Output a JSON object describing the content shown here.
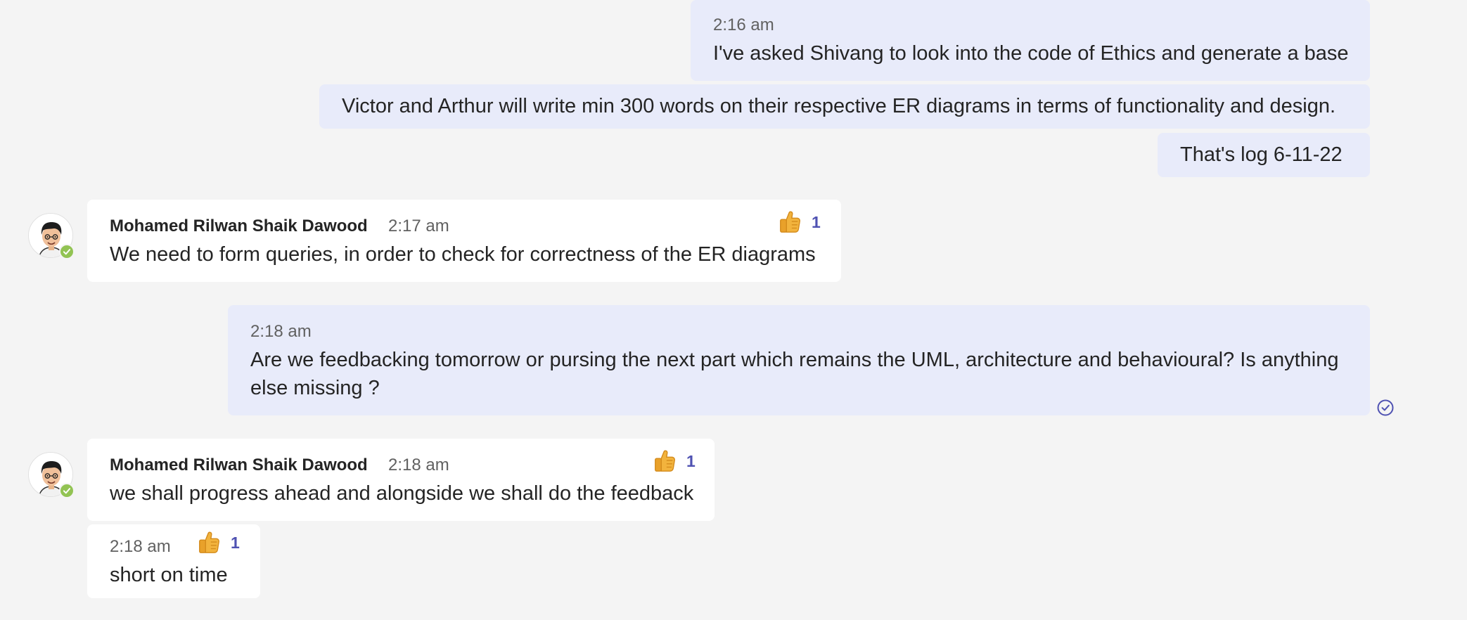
{
  "chat": {
    "messages": [
      {
        "side": "mine",
        "time": "2:16 am",
        "text": "I've asked Shivang to look into the code of Ethics and generate a base"
      },
      {
        "side": "mine",
        "text": "Victor and Arthur will write min 300 words on their respective ER diagrams in terms of functionality and design."
      },
      {
        "side": "mine",
        "text": "That's log 6-11-22"
      },
      {
        "side": "theirs",
        "sender": "Mohamed Rilwan Shaik Dawood",
        "time": "2:17 am",
        "text": "We need to form queries, in order to check for correctness of the ER diagrams",
        "reaction": {
          "icon": "thumbs-up-icon",
          "count": "1"
        }
      },
      {
        "side": "mine",
        "time": "2:18 am",
        "text": "Are we feedbacking tomorrow or pursing the next part which remains the UML, architecture and behavioural? Is anything else missing ?",
        "status_icon": "read-receipt-icon"
      },
      {
        "side": "theirs",
        "sender": "Mohamed Rilwan Shaik Dawood",
        "time": "2:18 am",
        "text": "we shall progress ahead and alongside we shall do the feedback",
        "reaction": {
          "icon": "thumbs-up-icon",
          "count": "1"
        }
      },
      {
        "side": "theirs",
        "time": "2:18 am",
        "text": "short on time",
        "reaction": {
          "icon": "thumbs-up-icon",
          "count": "1"
        }
      }
    ]
  },
  "colors": {
    "background": "#f4f4f4",
    "mine_bubble": "#e8ebfa",
    "theirs_bubble": "#ffffff",
    "accent": "#4f52b2",
    "presence_available": "#92c353"
  }
}
